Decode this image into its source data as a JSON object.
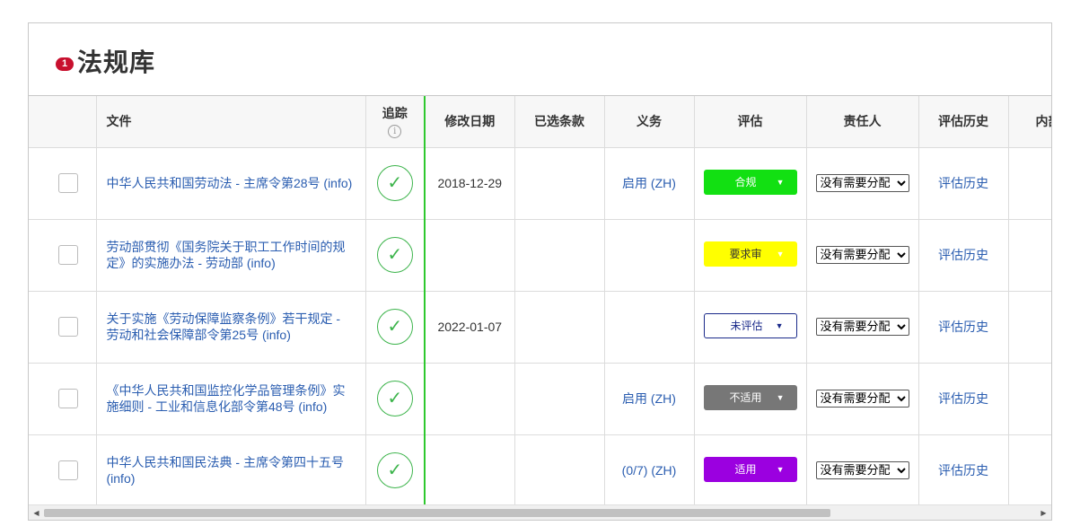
{
  "header": {
    "badge": "1",
    "title": "法规库"
  },
  "columns": {
    "document": "文件",
    "tracking": "追踪",
    "tracking_info": "i",
    "modified": "修改日期",
    "selected": "已选条款",
    "obligation": "义务",
    "evaluation": "评估",
    "owner": "责任人",
    "history": "评估历史",
    "internal": "内部"
  },
  "rows": [
    {
      "doc": "中华人民共和国劳动法 - 主席令第28号 (info)",
      "tracked": "✓",
      "date": "2018-12-29",
      "selected": "",
      "obligation": "启用 (ZH)",
      "eval": "合规",
      "owner": "没有需要分配",
      "history": "评估历史"
    },
    {
      "doc": "劳动部贯彻《国务院关于职工工作时间的规定》的实施办法 - 劳动部 (info)",
      "tracked": "✓",
      "date": "",
      "selected": "",
      "obligation": "",
      "eval": "要求审",
      "owner": "没有需要分配",
      "history": "评估历史"
    },
    {
      "doc": "关于实施《劳动保障监察条例》若干规定 - 劳动和社会保障部令第25号 (info)",
      "tracked": "✓",
      "date": "2022-01-07",
      "selected": "",
      "obligation": "",
      "eval": "未评估",
      "owner": "没有需要分配",
      "history": "评估历史"
    },
    {
      "doc": "《中华人民共和国监控化学品管理条例》实施细则 - 工业和信息化部令第48号 (info)",
      "tracked": "✓",
      "date": "",
      "selected": "",
      "obligation": "启用 (ZH)",
      "eval": "不适用",
      "owner": "没有需要分配",
      "history": "评估历史"
    },
    {
      "doc": "中华人民共和国民法典 - 主席令第四十五号 (info)",
      "tracked": "✓",
      "date": "",
      "selected": "",
      "obligation": "(0/7) (ZH)",
      "eval": "适用",
      "owner": "没有需要分配",
      "history": "评估历史"
    }
  ],
  "colors": {
    "eval_compliant": "#12e012",
    "eval_review": "#ffff00",
    "eval_unassessed": "#1a2a8a",
    "eval_na": "#777777",
    "eval_applicable": "#9b00e0",
    "tracking_line": "#2ec82e",
    "link": "#2a5db0"
  },
  "icons": {
    "tracked": "check-circle-icon",
    "dropdown": "caret-down-icon",
    "internal": "plus-circle-icon"
  }
}
